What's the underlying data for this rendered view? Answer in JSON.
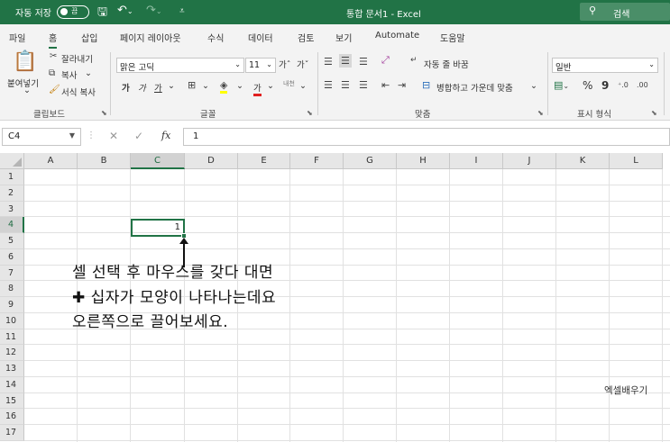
{
  "titlebar": {
    "autosave_label": "자동 저장",
    "autosave_state": "끔",
    "save_icon": "save-icon",
    "undo_icon": "undo-icon",
    "redo_icon": "redo-icon",
    "document_title": "통합 문서1  -  Excel",
    "search_placeholder": "검색"
  },
  "tabs": [
    "파일",
    "홈",
    "삽입",
    "페이지 레이아웃",
    "수식",
    "데이터",
    "검토",
    "보기",
    "Automate",
    "도움말"
  ],
  "active_tab": "홈",
  "ribbon": {
    "clipboard": {
      "paste_label_1": "붙여넣기",
      "paste_label_2": "⌄",
      "cut_label": "잘라내기",
      "copy_label": "복사",
      "copy_arrow": "⌄",
      "format_painter_label": "서식 복사",
      "group_label": "클립보드"
    },
    "font": {
      "font_name": "맑은 고딕",
      "font_size": "11",
      "grow_font": "가ˆ",
      "shrink_font": "가ˇ",
      "bold": "가",
      "italic": "가",
      "underline": "가",
      "underline_arrow": "⌄",
      "border_arrow": "⌄",
      "fill_arrow": "⌄",
      "font_color_letter": "가",
      "font_color_arrow": "⌄",
      "phonetic": "내천",
      "phonetic_arrow": "⌄",
      "group_label": "글꼴"
    },
    "alignment": {
      "wrap_text": "자동 줄 바꿈",
      "merge_center": "병합하고 가운데 맞춤",
      "merge_arrow": "⌄",
      "group_label": "맞춤"
    },
    "number": {
      "format": "일반",
      "percent": "%",
      "comma": "9",
      "group_label": "표시 형식"
    }
  },
  "formula_bar": {
    "name_box": "C4",
    "cancel": "✕",
    "enter": "✓",
    "fx": "fx",
    "value": "1"
  },
  "grid": {
    "columns": [
      "A",
      "B",
      "C",
      "D",
      "E",
      "F",
      "G",
      "H",
      "I",
      "J",
      "K",
      "L"
    ],
    "rows": [
      "1",
      "2",
      "3",
      "4",
      "5",
      "6",
      "7",
      "8",
      "9",
      "10",
      "11",
      "12",
      "13",
      "14",
      "15",
      "16",
      "17"
    ],
    "selected_cell_value": "1"
  },
  "annotation": {
    "line1": "셀 선택 후 마우스를 갖다 대면",
    "line2": "✚ 십자가 모양이 나타나는데요",
    "line3": "오른쪽으로 끌어보세요."
  },
  "watermark": "엑셀배우기",
  "colors": {
    "excel_green": "#217346",
    "ribbon_bg": "#f3f3f3",
    "header_bg": "#e6e6e6"
  }
}
